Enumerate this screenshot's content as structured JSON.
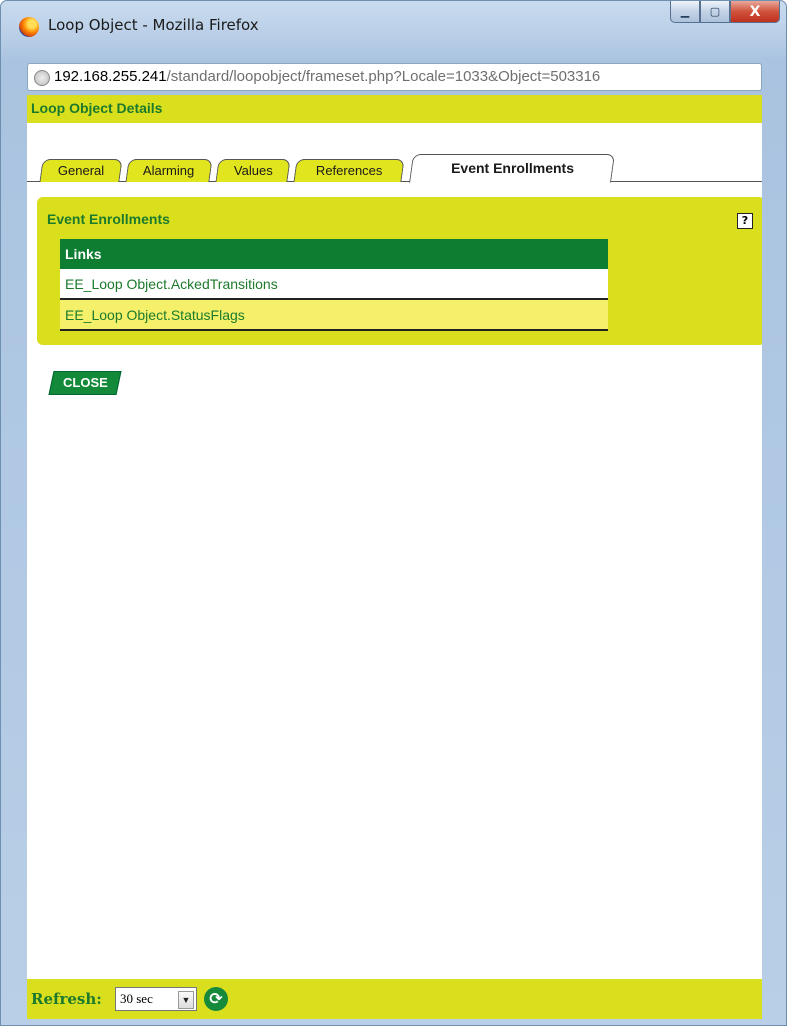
{
  "window": {
    "title": "Loop Object - Mozilla Firefox",
    "icon": "firefox-icon",
    "controls": {
      "minimize": "▁",
      "maximize": "▢",
      "close": "X"
    }
  },
  "urlbar": {
    "host": "192.168.255.241",
    "path": "/standard/loopobject/frameset.php?Locale=1033&Object=503316"
  },
  "page": {
    "title": "Loop Object Details"
  },
  "tabs": [
    {
      "label": "General"
    },
    {
      "label": "Alarming"
    },
    {
      "label": "Values"
    },
    {
      "label": "References"
    },
    {
      "label": "Event Enrollments",
      "active": true
    }
  ],
  "panel": {
    "title": "Event Enrollments",
    "help": "?",
    "table": {
      "header": "Links",
      "rows": [
        "EE_Loop Object.AckedTransitions",
        "EE_Loop Object.StatusFlags"
      ]
    }
  },
  "close_button": "CLOSE",
  "refresh": {
    "label": "Refresh:",
    "value": "30 sec",
    "arrow": "▼",
    "icon": "refresh-icon"
  },
  "colors": {
    "accent_yellow": "#d9df1d",
    "accent_green": "#0d7d32",
    "row_highlight": "#f4f06a"
  }
}
